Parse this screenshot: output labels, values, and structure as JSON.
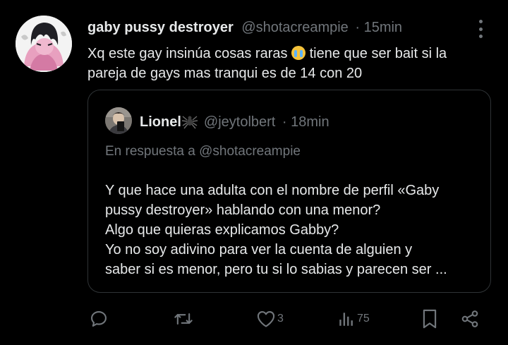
{
  "post": {
    "author_name": "gaby pussy destroyer",
    "author_handle": "@shotacreampie",
    "time": "· 15min",
    "text_before_emoji": "Xq este gay insinúa cosas raras",
    "emoji": "loudly-crying-face",
    "text_after_emoji": " tiene que ser bait si la pareja de gays mas tranqui es de 14 con 20"
  },
  "quote": {
    "author_name": "Lionel",
    "name_emoji": "spider-icon",
    "author_handle": "@jeytolbert",
    "time": "· 18min",
    "reply_to": "En respuesta a @shotacreampie",
    "lines": [
      "Y que hace una adulta con el nombre de perfil «Gaby",
      "pussy destroyer» hablando con una menor?",
      "Algo que quieras explicamos Gabby?",
      "Yo no soy adivino para ver la cuenta de alguien y",
      "saber si es menor, pero tu si lo sabias y parecen ser ..."
    ]
  },
  "actions": {
    "reply": {
      "icon": "reply-icon"
    },
    "repost": {
      "icon": "repost-icon"
    },
    "like": {
      "icon": "heart-icon",
      "count": "3"
    },
    "views": {
      "icon": "views-icon",
      "count": "75"
    },
    "bookmark": {
      "icon": "bookmark-icon"
    },
    "share": {
      "icon": "share-icon"
    }
  },
  "colors": {
    "background": "#000000",
    "text": "#e7e9ea",
    "muted": "#71767b",
    "border": "#2f3336",
    "avatar_accent": "#e8a0bf"
  }
}
